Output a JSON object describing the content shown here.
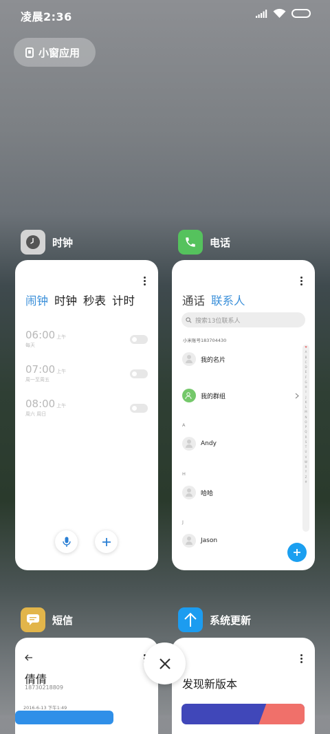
{
  "status_bar": {
    "time": "凌晨2:36"
  },
  "float_window": {
    "label": "小窗应用"
  },
  "apps": [
    {
      "name": "时钟",
      "icon": "clock-icon",
      "color": "#d8d8d8"
    },
    {
      "name": "电话",
      "icon": "phone-icon",
      "color": "#55c25d"
    },
    {
      "name": "短信",
      "icon": "message-icon",
      "color": "#e2b54a"
    },
    {
      "name": "系统更新",
      "icon": "update-arrow-icon",
      "color": "#1c9cf0"
    }
  ],
  "clock": {
    "tabs": [
      "闹钟",
      "时钟",
      "秒表",
      "计时"
    ],
    "alarms": [
      {
        "time": "06:00",
        "ampm": "上午",
        "repeat": "每天"
      },
      {
        "time": "07:00",
        "ampm": "上午",
        "repeat": "周一至周五"
      },
      {
        "time": "08:00",
        "ampm": "上午",
        "repeat": "周六 周日"
      }
    ]
  },
  "phone": {
    "tabs": [
      "通话",
      "联系人"
    ],
    "search_placeholder": "搜索13位联系人",
    "account": "小米账号183704430",
    "my_card": "我的名片",
    "my_group": "我的群组",
    "sections": [
      {
        "letter": "A",
        "contact": "Andy"
      },
      {
        "letter": "H",
        "contact": "哈哈"
      },
      {
        "letter": "J",
        "contact": "Jason"
      }
    ],
    "index_letters": [
      "♥",
      "A",
      "B",
      "C",
      "D",
      "E",
      "F",
      "G",
      "H",
      "I",
      "J",
      "K",
      "L",
      "M",
      "N",
      "O",
      "P",
      "Q",
      "R",
      "S",
      "T",
      "U",
      "V",
      "W",
      "X",
      "Y",
      "Z",
      "#"
    ]
  },
  "sms": {
    "name": "倩倩",
    "number": "18730218809",
    "date": "2016-6-13 下午1:49"
  },
  "update": {
    "title": "发现新版本"
  }
}
